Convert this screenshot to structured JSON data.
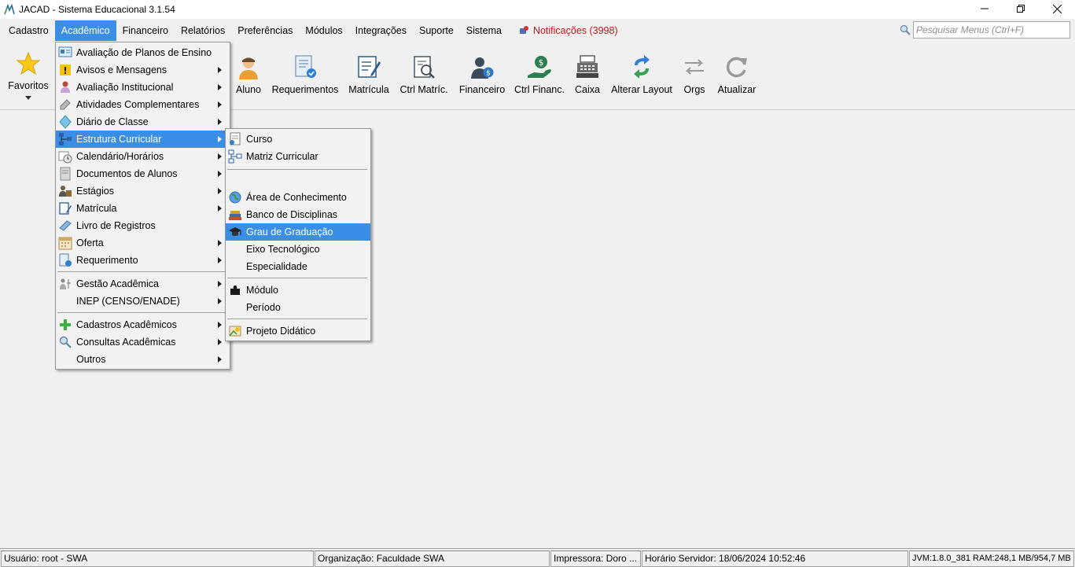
{
  "window": {
    "title": "JACAD - Sistema Educacional 3.1.54",
    "minimize_glyph": "—",
    "restore_glyph": "❐",
    "close_glyph": "✕"
  },
  "menubar": {
    "items": [
      "Cadastro",
      "Acadêmico",
      "Financeiro",
      "Relatórios",
      "Preferências",
      "Módulos",
      "Integrações",
      "Suporte",
      "Sistema"
    ],
    "active": "Acadêmico",
    "notifications": "Notificações (3998)",
    "notifications_color": "#c01818",
    "search_placeholder": "Pesquisar Menus (Ctrl+F)"
  },
  "toolbar": {
    "favorites": "Favoritos",
    "buttons": [
      "Aluno",
      "Requerimentos",
      "Matrícula",
      "Ctrl Matríc.",
      "Financeiro",
      "Ctrl Financ.",
      "Caixa",
      "Alterar Layout",
      "Orgs",
      "Atualizar"
    ]
  },
  "academico_menu": {
    "items": [
      {
        "label": "Avaliação de Planos de Ensino",
        "icon": "plan-icon"
      },
      {
        "label": "Avisos e Mensagens",
        "icon": "warning-icon"
      },
      {
        "label": "Avaliação Institucional",
        "icon": "person-chart-icon"
      },
      {
        "label": "Atividades Complementares",
        "icon": "pencil-icon"
      },
      {
        "label": "Diário de Classe",
        "icon": "diary-icon"
      },
      {
        "label": "Estrutura Curricular",
        "icon": "structure-icon"
      },
      {
        "label": "Calendário/Horários",
        "icon": "calendar-clock-icon"
      },
      {
        "label": "Documentos de Alunos",
        "icon": "document-icon"
      },
      {
        "label": "Estágios",
        "icon": "intern-icon"
      },
      {
        "label": "Matrícula",
        "icon": "enroll-icon"
      },
      {
        "label": "Livro de Registros",
        "icon": "book-icon"
      },
      {
        "label": "Oferta",
        "icon": "offer-calendar-icon"
      },
      {
        "label": "Requerimento",
        "icon": "request-icon"
      },
      {
        "label": "Gestão Acadêmica",
        "icon": "management-icon"
      },
      {
        "label": "INEP (CENSO/ENADE)",
        "icon": ""
      },
      {
        "label": "Cadastros Acadêmicos",
        "icon": "plus-icon"
      },
      {
        "label": "Consultas Acadêmicas",
        "icon": "magnifier-icon"
      },
      {
        "label": "Outros",
        "icon": ""
      }
    ],
    "highlighted": "Estrutura Curricular"
  },
  "estrutura_submenu": {
    "items": [
      {
        "label": "Curso",
        "icon": "course-icon"
      },
      {
        "label": "Matriz Curricular",
        "icon": "matrix-icon"
      },
      {
        "label": "Área de Conhecimento",
        "icon": "globe-icon"
      },
      {
        "label": "Banco de Disciplinas",
        "icon": "books-icon"
      },
      {
        "label": "Grau de Graduação",
        "icon": "graduation-cap-icon"
      },
      {
        "label": "Eixo Tecnológico",
        "icon": ""
      },
      {
        "label": "Especialidade",
        "icon": ""
      },
      {
        "label": "Módulo",
        "icon": "puzzle-icon"
      },
      {
        "label": "Período",
        "icon": ""
      },
      {
        "label": "Projeto Didático",
        "icon": "project-icon"
      }
    ],
    "highlighted": "Grau de Graduação"
  },
  "statusbar": {
    "user": "Usuário: root - SWA",
    "organization": "Organização: Faculdade SWA",
    "printer": "Impressora: Doro ...",
    "server_time": "Horário Servidor: 18/06/2024 10:52:46",
    "jvm": "JVM:1.8.0_381  RAM:248,1 MB/954,7 MB"
  },
  "colors": {
    "highlight": "#3a8ee6",
    "background": "#f0f0f0"
  }
}
